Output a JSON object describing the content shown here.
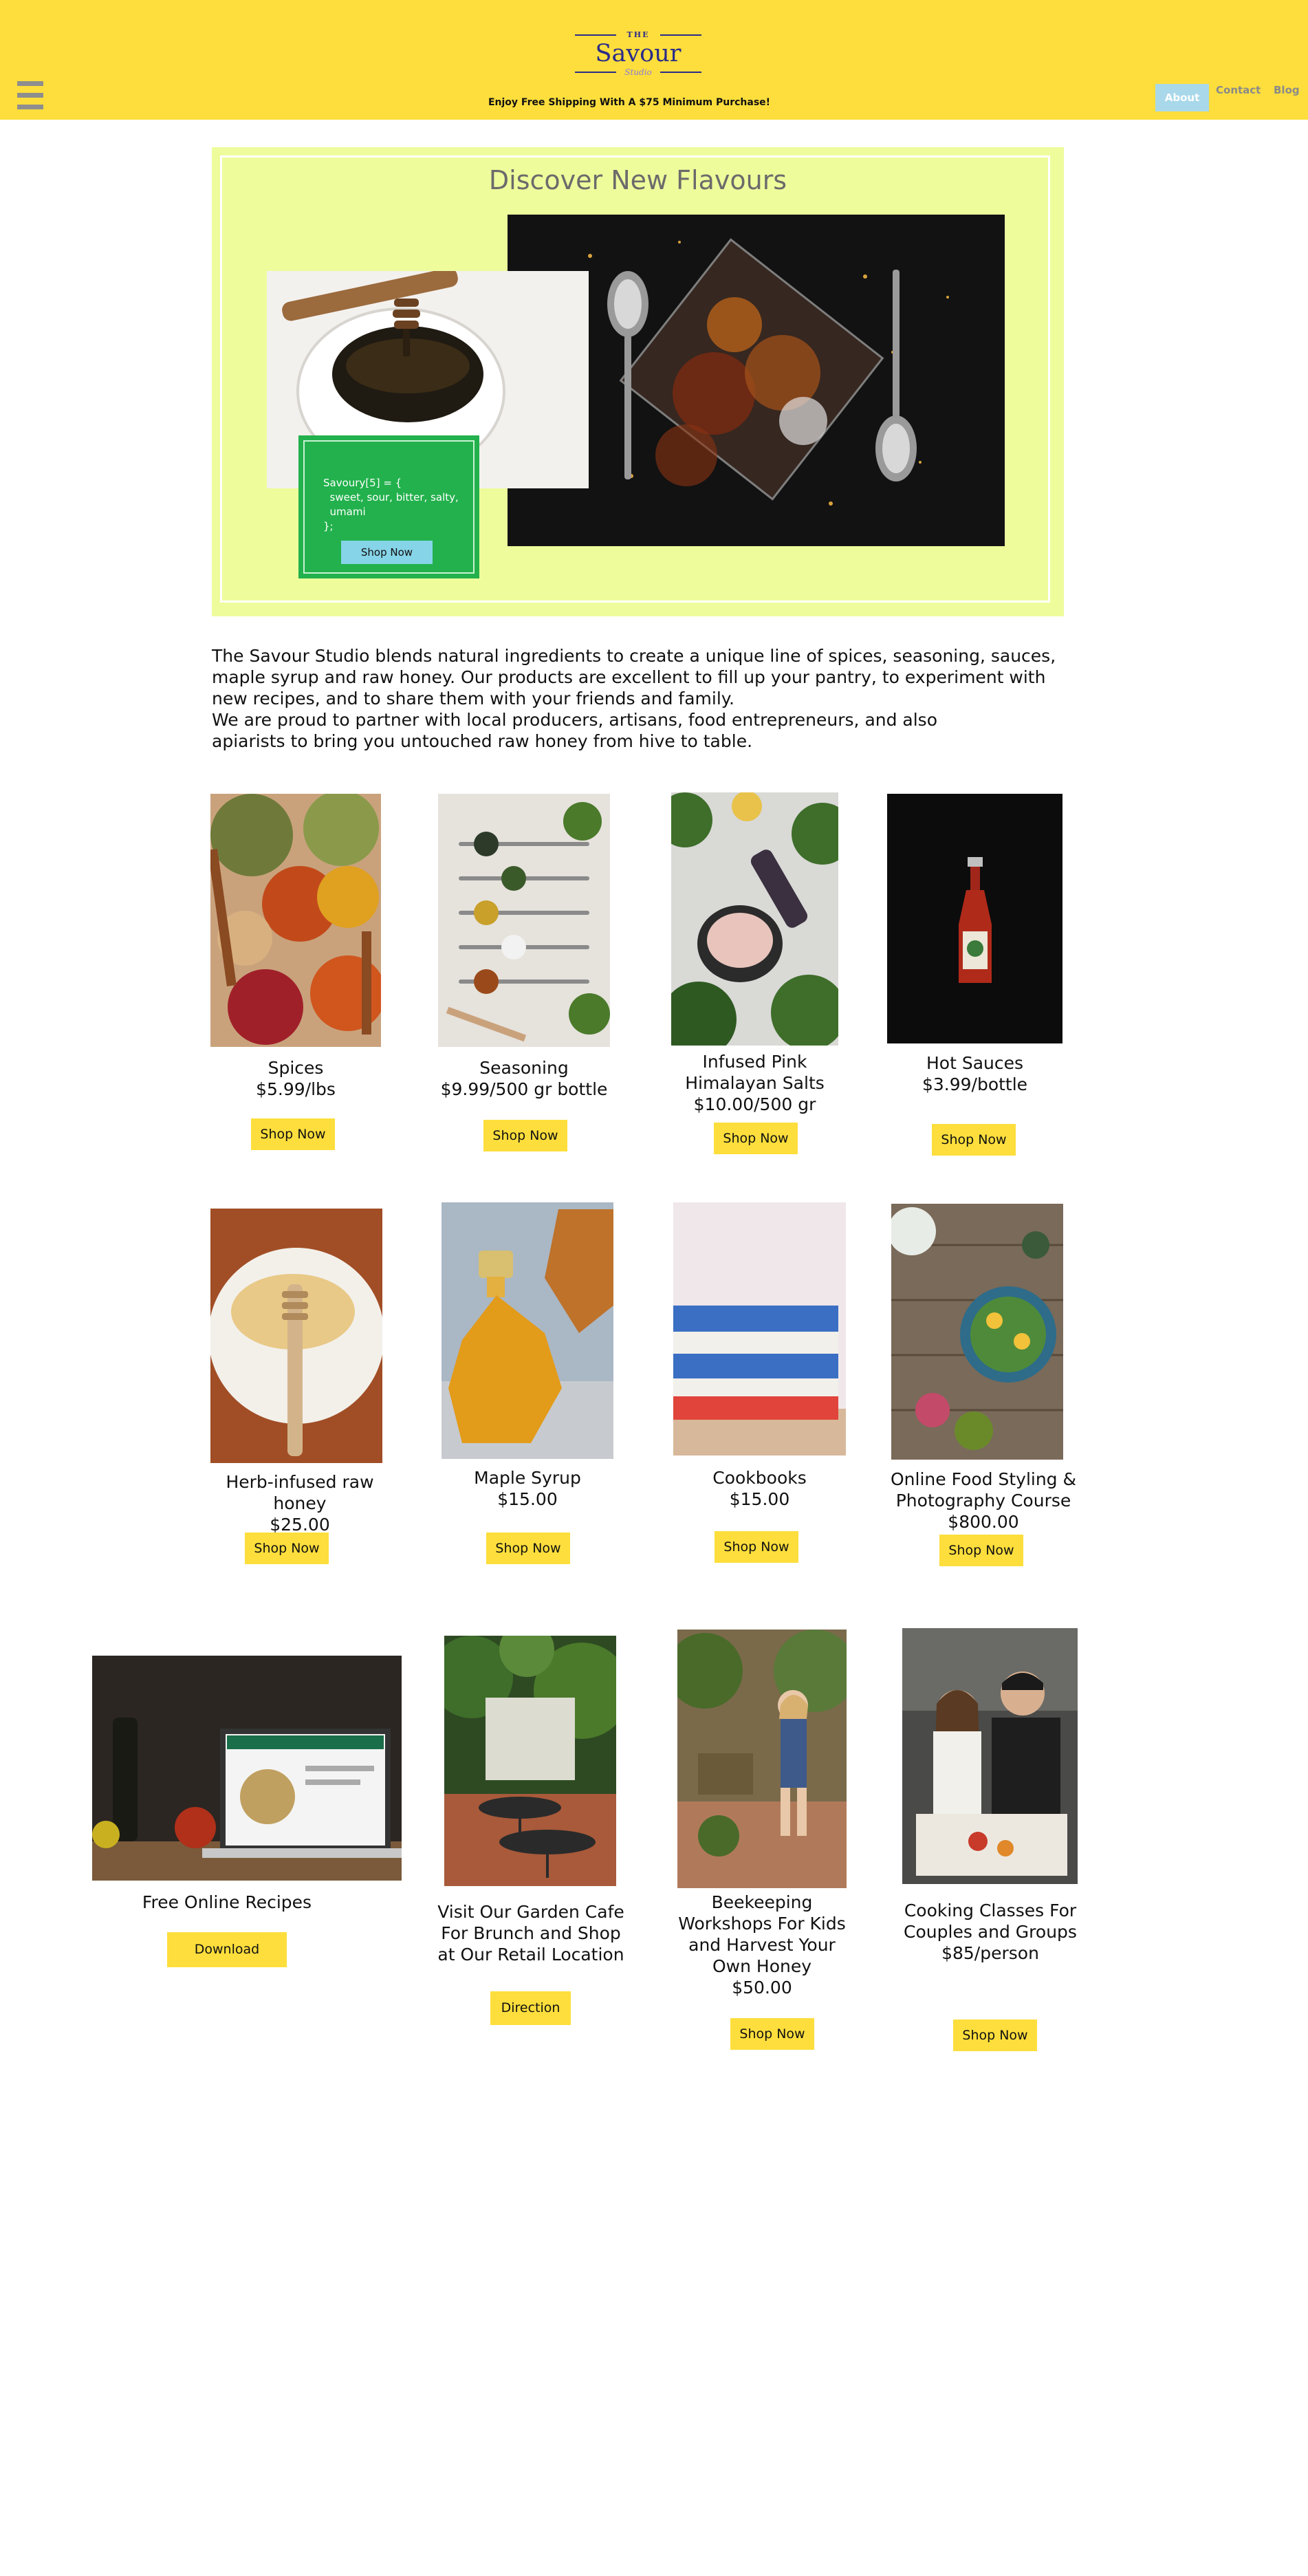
{
  "header": {
    "logo": {
      "the": "THE",
      "name": "Savour",
      "studio": "Studio"
    },
    "shipping": "Enjoy Free Shipping With A $75 Minimum Purchase!",
    "nav": {
      "about": "About",
      "contact": "Contact",
      "blog": "Blog"
    }
  },
  "hero": {
    "title": "Discover New Flavours",
    "code_lines": [
      "Savoury[5] = {",
      "  sweet, sour, bitter, salty,",
      "  umami",
      "};"
    ],
    "button": "Shop Now"
  },
  "intro": [
    "The Savour Studio blends natural ingredients to create a unique line of spices, seasoning, sauces, maple syrup and raw honey. Our products are excellent to fill up your pantry, to experiment with new recipes, and to share them with your friends and family.",
    "We are proud to partner with local producers, artisans, food entrepreneurs, and also apiarists to bring you untouched raw honey from hive to table."
  ],
  "products": [
    {
      "lines": [
        "Spices",
        "$5.99/lbs"
      ],
      "button": "Shop Now",
      "image": "spices-photo"
    },
    {
      "lines": [
        "Seasoning",
        "$9.99/500 gr bottle"
      ],
      "button": "Shop Now",
      "image": "seasoning-photo"
    },
    {
      "lines": [
        "Infused Pink",
        "Himalayan Salts",
        "$10.00/500 gr"
      ],
      "button": "Shop Now",
      "image": "salts-photo"
    },
    {
      "lines": [
        "Hot Sauces",
        "$3.99/bottle"
      ],
      "button": "Shop Now",
      "image": "hot-sauce-photo"
    },
    {
      "lines": [
        "Herb-infused raw honey",
        "$25.00"
      ],
      "button": "Shop Now",
      "image": "honey-photo"
    },
    {
      "lines": [
        "Maple Syrup",
        "$15.00"
      ],
      "button": "Shop Now",
      "image": "maple-syrup-photo"
    },
    {
      "lines": [
        "Cookbooks",
        "$15.00"
      ],
      "button": "Shop Now",
      "image": "cookbooks-photo"
    },
    {
      "lines": [
        "Online Food Styling &",
        "Photography Course",
        "$800.00"
      ],
      "button": "Shop Now",
      "image": "food-styling-photo"
    },
    {
      "lines": [
        "Free Online Recipes"
      ],
      "button": "Download",
      "image": "laptop-recipes-photo"
    },
    {
      "lines": [
        "Visit Our Garden Cafe",
        "For Brunch and Shop",
        "at Our Retail Location"
      ],
      "button": "Direction",
      "image": "garden-cafe-photo"
    },
    {
      "lines": [
        "Beekeeping",
        "Workshops For Kids",
        "and Harvest Your",
        "Own Honey",
        "$50.00"
      ],
      "button": "Shop Now",
      "image": "beekeeping-photo"
    },
    {
      "lines": [
        "Cooking Classes For",
        "Couples and Groups",
        "$85/person"
      ],
      "button": "Shop Now",
      "image": "cooking-class-photo"
    }
  ],
  "colors": {
    "header": "#fdde3c",
    "hero": "#eefc9c",
    "code_box": "#22b14c",
    "about_tab": "#a8d8ea",
    "button": "#fdde3c"
  }
}
